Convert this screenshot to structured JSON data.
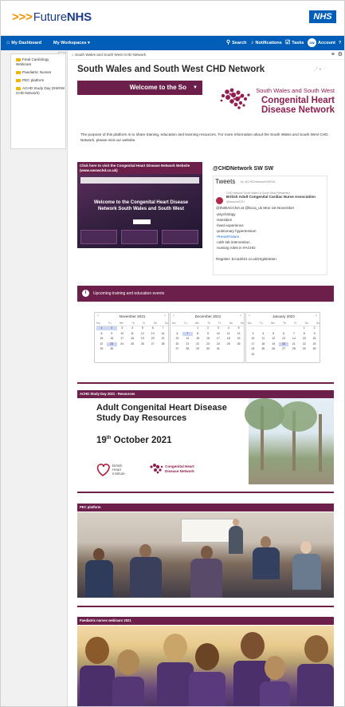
{
  "brand": {
    "chevrons": ">>>",
    "name_prefix": "Future",
    "name_suffix": "NHS",
    "nhs_mark": "NHS"
  },
  "nav": {
    "dashboard": "My Dashboard",
    "workspaces": "My Workspaces",
    "search": "Search",
    "notifications": "Notifications",
    "tasks": "Tasks",
    "account": "Account",
    "avatar_initials": "SW"
  },
  "sidebar": {
    "items": [
      {
        "label": "Fetal Cardiology Webinars"
      },
      {
        "label": "Paediatric Nurses"
      },
      {
        "label": "PEC platform"
      },
      {
        "label": "ACHD Study Day (SWSW CHD Network)"
      }
    ]
  },
  "breadcrumb": {
    "text": "South Wales and South West CHD Network"
  },
  "page": {
    "title": "South Wales and South West CHD Network",
    "welcome_label": "Welcome to the So",
    "logo": {
      "line1": "South Wales and South West",
      "line2": "Congenital Heart",
      "line3": "Disease Network"
    },
    "intro": "The purpose of this platform is to share training, education and learning resources.  For more information about the South Wales and South West CHD Network, please visit our website."
  },
  "promo": {
    "header": "Click here to visit the Congenital Heart Disease Network Website (www.swswchd.co.uk)",
    "hero_text": "Welcome to the Congenital Heart Disease Network South Wales and South West"
  },
  "twitter": {
    "handle_title": "@CHDNetwork SW SW",
    "tweets_label": "Tweets",
    "tweets_by": "by @CHDNetworkSWSW",
    "retweet_note": "CHD Network South Wales & South West Retweeted",
    "account_name": "British Adult Congenital Cardiac Nurse Association",
    "account_handle": "@baccna2021",
    "lines": [
      "@theBACCNA at @bcca_uk Mon 1st November",
      "-psychology",
      "-transition",
      "-lived experience",
      "-pulmonary hypertension",
      "-#HeartFailure",
      "-cath lab intervention",
      "-nursing roles in #ACHD",
      "",
      "Register: bcca2021.co.uk/registration"
    ]
  },
  "events": {
    "label": "Upcoming training and education events"
  },
  "calendars": [
    {
      "month": "November 2021",
      "days": [
        "Mo",
        "Tu",
        "We",
        "Th",
        "Fr",
        "Sa",
        "Su"
      ],
      "cells": [
        "1",
        "2",
        "3",
        "4",
        "5",
        "6",
        "7",
        "8",
        "9",
        "10",
        "11",
        "12",
        "13",
        "14",
        "15",
        "16",
        "17",
        "18",
        "19",
        "20",
        "21",
        "22",
        "23",
        "24",
        "25",
        "26",
        "27",
        "28",
        "29",
        "30",
        "",
        "",
        "",
        "",
        ""
      ],
      "highlights": [
        "1",
        "2",
        "23"
      ]
    },
    {
      "month": "December 2021",
      "days": [
        "Mo",
        "Tu",
        "We",
        "Th",
        "Fr",
        "Sa",
        "Su"
      ],
      "cells": [
        "",
        "",
        "1",
        "2",
        "3",
        "4",
        "5",
        "6",
        "7",
        "8",
        "9",
        "10",
        "11",
        "12",
        "13",
        "14",
        "15",
        "16",
        "17",
        "18",
        "19",
        "20",
        "21",
        "22",
        "23",
        "24",
        "25",
        "26",
        "27",
        "28",
        "29",
        "30",
        "31",
        "",
        ""
      ],
      "highlights": [
        "7"
      ]
    },
    {
      "month": "January 2022",
      "days": [
        "Mo",
        "Tu",
        "We",
        "Th",
        "Fr",
        "Sa",
        "Su"
      ],
      "cells": [
        "",
        "",
        "",
        "",
        "",
        "1",
        "2",
        "3",
        "4",
        "5",
        "6",
        "7",
        "8",
        "9",
        "10",
        "11",
        "12",
        "13",
        "14",
        "15",
        "16",
        "17",
        "18",
        "19",
        "20",
        "21",
        "22",
        "23",
        "24",
        "25",
        "26",
        "27",
        "28",
        "29",
        "30",
        "31",
        "",
        "",
        "",
        "",
        "",
        ""
      ],
      "highlights": [
        "20"
      ]
    }
  ],
  "study_day": {
    "header": "ACHD Study Day 2021 - Resources",
    "title_line1": "Adult Congenital Heart Disease",
    "title_line2": "Study Day Resources",
    "date_day": "19",
    "date_suffix": "th",
    "date_rest": "October 2021",
    "bhi_text": "British Heart Institute",
    "chd_mini": "Congenital Heart Disease Network"
  },
  "pec": {
    "header": "PEC platform"
  },
  "nurses": {
    "header": "Paediatric nurses webinars 2021"
  },
  "colors": {
    "brand_blue": "#005eb8",
    "network_plum": "#6b1f4a",
    "accent_orange": "#f29100"
  }
}
